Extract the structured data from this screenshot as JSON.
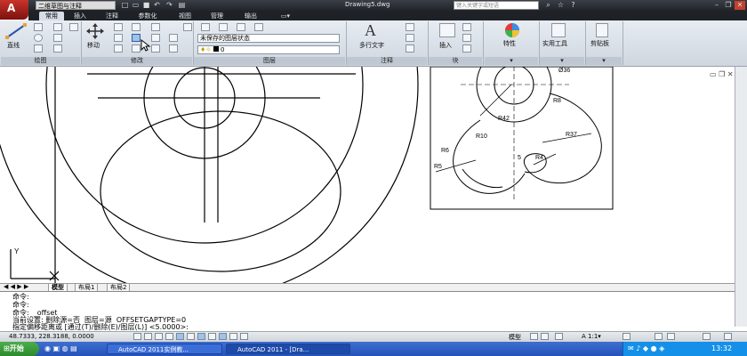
{
  "title_bar": {
    "workspace": "二维草图与注释",
    "document": "Drawing5.dwg",
    "search_placeholder": "键入关键字或短语"
  },
  "tabs": [
    "常用",
    "插入",
    "注释",
    "参数化",
    "视图",
    "管理",
    "输出"
  ],
  "ribbon": {
    "draw_line": "直线",
    "modify_move": "移动",
    "layer_state": "未保存的图层状态",
    "layer_current": "0",
    "annot_mtext": "多行文字",
    "block_insert": "插入",
    "properties": "特性",
    "utilities": "实用工具",
    "clipboard": "剪贴板",
    "panels": [
      "绘图",
      "修改",
      "图层",
      "注释",
      "块"
    ]
  },
  "drawing": {
    "dims": [
      "Ø36",
      "R8",
      "R42",
      "R10",
      "R37",
      "R6",
      "R5",
      "5",
      "R4"
    ],
    "ucs_y": "Y",
    "ucs_x": "X"
  },
  "layout_tabs": [
    "模型",
    "布局1",
    "布局2"
  ],
  "command": {
    "lines": [
      "命令:",
      "命令:",
      "命令:  _offset",
      "当前设置: 删除源=否  图层=源  OFFSETGAPTYPE=0",
      "指定偏移距离或 [通过(T)/删除(E)/图层(L)] <5.0000>:"
    ]
  },
  "status": {
    "coords": "48.7333, 228.3188, 0.0000",
    "model": "模型",
    "scale": "1:1"
  },
  "taskbar": {
    "start": "开始",
    "tasks": [
      "AutoCAD 2011实例教...",
      "AutoCAD 2011 - [Dra..."
    ],
    "clock": "13:32"
  },
  "colors": {
    "titlebar": "#2a2e33",
    "app_button": "#b5261f",
    "taskbar": "#2f60c8"
  }
}
